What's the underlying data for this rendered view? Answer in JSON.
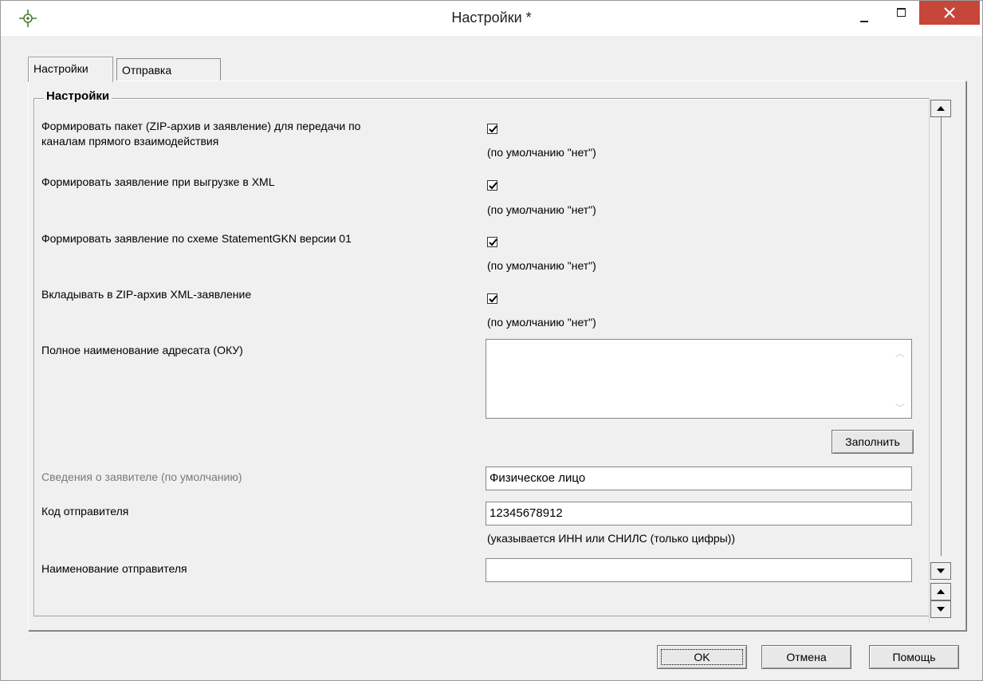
{
  "window": {
    "title": "Настройки *",
    "icon": "crosshair-icon",
    "controls": [
      "minimize-icon",
      "maximize-icon",
      "close-icon"
    ],
    "close_color": "#c7463a"
  },
  "tabs": [
    {
      "label": "Настройки",
      "active": true
    },
    {
      "label": "Отправка",
      "active": false
    }
  ],
  "group": {
    "title": "Настройки"
  },
  "settings": [
    {
      "label_line1": "Формировать пакет (ZIP-архив и заявление) для передачи по",
      "label_line2": "каналам прямого взаимодействия",
      "checked": true,
      "hint": "(по умолчанию \"нет\")"
    },
    {
      "label": "Формировать заявление при выгрузке в XML",
      "checked": true,
      "hint": "(по умолчанию \"нет\")"
    },
    {
      "label": "Формировать заявление по схеме StatementGKN версии 01",
      "checked": true,
      "hint": "(по умолчанию \"нет\")"
    },
    {
      "label": "Вкладывать в ZIP-архив XML-заявление",
      "checked": true,
      "hint": "(по умолчанию \"нет\")"
    }
  ],
  "recipient": {
    "label": "Полное наименование адресата (ОКУ)",
    "value": "",
    "fill_button": "Заполнить"
  },
  "applicant": {
    "label": "Сведения о заявителе (по умолчанию)",
    "value": "Физическое лицо"
  },
  "sender_code": {
    "label": "Код отправителя",
    "value": "12345678912",
    "hint": "(указывается ИНН или СНИЛС (только цифры))"
  },
  "sender_name": {
    "label": "Наименование отправителя",
    "value": ""
  },
  "footer": {
    "ok": "OK",
    "cancel": "Отмена",
    "help": "Помощь"
  }
}
